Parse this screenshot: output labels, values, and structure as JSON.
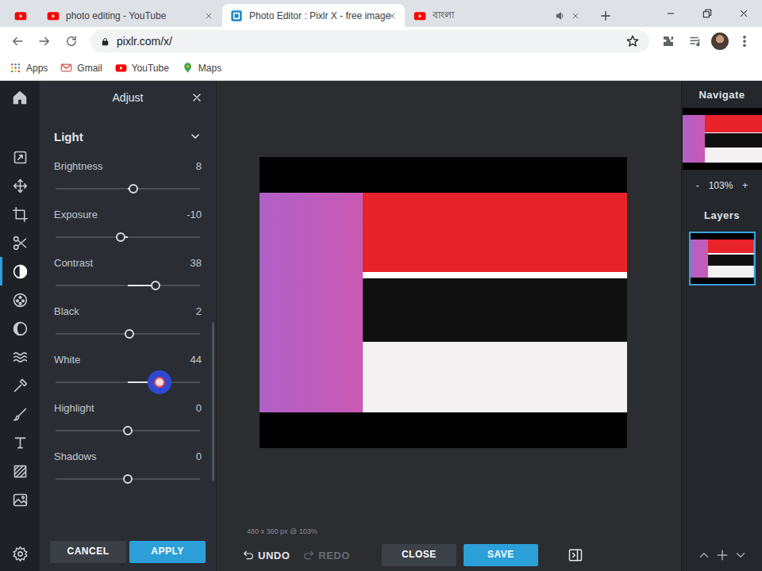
{
  "browser": {
    "tabs": [
      {
        "kind": "pinned",
        "selected": false,
        "color": "#ff0000",
        "audio": false
      },
      {
        "kind": "page",
        "label": "photo editing - YouTube",
        "selected": false,
        "color": "#ff0000",
        "audio": false
      },
      {
        "kind": "page",
        "label": "Photo Editor : Pixlr X - free image",
        "selected": true,
        "color": "#1c87c9",
        "audio": false
      },
      {
        "kind": "page",
        "label": "বাংলা",
        "selected": false,
        "color": "#ff0000",
        "audio": true
      }
    ],
    "address": {
      "url": "pixlr.com/x/"
    },
    "bookmarks": [
      {
        "label": "Apps",
        "kind": "apps"
      },
      {
        "label": "Gmail",
        "kind": "mail"
      },
      {
        "label": "YouTube",
        "kind": "video"
      },
      {
        "label": "Maps",
        "kind": "map"
      }
    ]
  },
  "tools": {
    "items": [
      {
        "selected": false
      },
      {
        "selected": false
      },
      {
        "selected": false
      },
      {
        "selected": false
      },
      {
        "selected": true
      },
      {
        "selected": false
      },
      {
        "selected": false
      },
      {
        "selected": false
      },
      {
        "selected": false
      },
      {
        "selected": false
      },
      {
        "selected": false
      },
      {
        "selected": false
      },
      {
        "selected": false
      }
    ]
  },
  "panel": {
    "title": "Adjust",
    "section": {
      "title": "Light",
      "expanded": true
    },
    "sliders": [
      {
        "label": "Brightness",
        "reading": "8",
        "level": 0.54,
        "active": false
      },
      {
        "label": "Exposure",
        "reading": "-10",
        "level": 0.45,
        "active": false
      },
      {
        "label": "Contrast",
        "reading": "38",
        "level": 0.69,
        "active": false
      },
      {
        "label": "Black",
        "reading": "2",
        "level": 0.51,
        "active": false
      },
      {
        "label": "White",
        "reading": "44",
        "level": 0.72,
        "active": true
      },
      {
        "label": "Highlight",
        "reading": "0",
        "level": 0.5,
        "active": false
      },
      {
        "label": "Shadows",
        "reading": "0",
        "level": 0.5,
        "active": false
      }
    ],
    "cancel": "CANCEL",
    "apply": "APPLY"
  },
  "canvas": {
    "info": "480 x 360 px @ 103%"
  },
  "toolbar": {
    "undo": {
      "label": "UNDO",
      "disabled": false
    },
    "redo": {
      "label": "REDO",
      "disabled": true
    },
    "close": "CLOSE",
    "save": "SAVE"
  },
  "navigator": {
    "title": "Navigate",
    "zoom_out": "-",
    "zoom": "103%",
    "zoom_in": "+"
  },
  "layers": {
    "title": "Layers",
    "items": [
      {
        "selected": true
      }
    ]
  }
}
